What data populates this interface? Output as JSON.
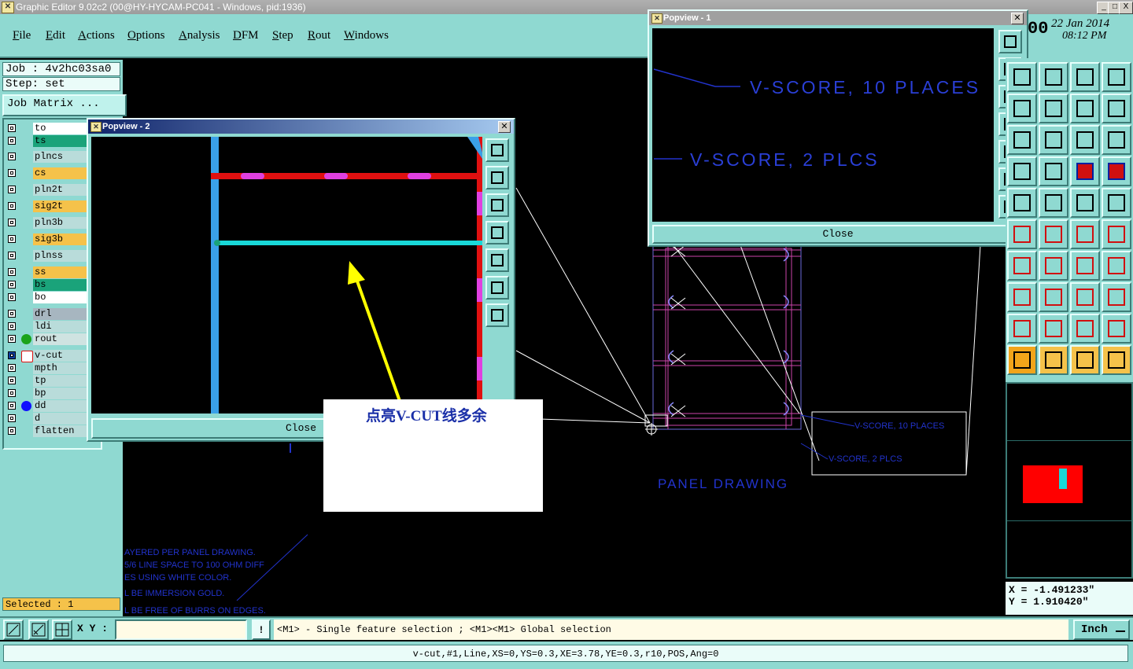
{
  "window": {
    "title": "Graphic Editor 9.02c2 (00@HY-HYCAM-PC041 - Windows, pid:1936)",
    "buttons": [
      "_",
      "□",
      "X"
    ]
  },
  "menu": [
    "File",
    "Edit",
    "Actions",
    "Options",
    "Analysis",
    "DFM",
    "Step",
    "Rout",
    "Windows"
  ],
  "datetime": {
    "clock": "00",
    "date": "22 Jan 2014",
    "time": "08:12 PM"
  },
  "job": {
    "job_label": "Job : 4v2hc03sa0",
    "step_label": "Step: set",
    "matrix_button": "Job Matrix ..."
  },
  "layers": [
    {
      "name": "to",
      "color": "#ffffff"
    },
    {
      "name": "ts",
      "color": "#1aa37a"
    },
    {
      "name": "plncs",
      "color": "#b9dcda"
    },
    {
      "name": "cs",
      "color": "#f5c24a"
    },
    {
      "name": "pln2t",
      "color": "#b9dcda"
    },
    {
      "name": "sig2t",
      "color": "#f5c24a"
    },
    {
      "name": "pln3b",
      "color": "#b9dcda"
    },
    {
      "name": "sig3b",
      "color": "#f5c24a"
    },
    {
      "name": "plnss",
      "color": "#b9dcda"
    },
    {
      "name": "ss",
      "color": "#f5c24a"
    },
    {
      "name": "bs",
      "color": "#1aa37a"
    },
    {
      "name": "bo",
      "color": "#ffffff"
    },
    {
      "name": "drl",
      "color": "#a7b6c0"
    },
    {
      "name": "ldi",
      "color": "#b9dcda"
    },
    {
      "name": "rout",
      "color": "#cfe3e1"
    },
    {
      "name": "v-cut",
      "color": "#b9dcda"
    },
    {
      "name": "mpth",
      "color": "#b9dcda"
    },
    {
      "name": "tp",
      "color": "#b9dcda"
    },
    {
      "name": "bp",
      "color": "#b9dcda"
    },
    {
      "name": "dd",
      "color": "#b9dcda"
    },
    {
      "name": "d",
      "color": "#b9dcda"
    },
    {
      "name": "flatten",
      "color": "#b9dcda"
    }
  ],
  "selected": "Selected : 1",
  "popview1": {
    "title": "Popview - 1",
    "line1": "V-SCORE, 10 PLACES",
    "line2": "V-SCORE, 2 PLCS",
    "close": "Close"
  },
  "popview2": {
    "title": "Popview - 2",
    "close": "Close"
  },
  "annotation": "点亮V-CUT线多余",
  "canvas_text": {
    "vscore10": "V-SCORE, 10 PLACES",
    "vscore2": "V-SCORE, 2 PLCS",
    "panel": "PANEL DRAWING",
    "notes": [
      "AYERED PER PANEL DRAWING.",
      "5/6 LINE SPACE TO 100 OHM DIFF",
      "ES USING WHITE COLOR.",
      "L BE IMMERSION GOLD.",
      "L BE FREE OF BURRS ON EDGES."
    ]
  },
  "coords": {
    "x": "X = -1.491233\"",
    "y": "Y = 1.910420\""
  },
  "bottombar": {
    "xy_label": "X Y :",
    "xy_value": "",
    "warn": "!",
    "hint": "<M1> - Single feature selection ; <M1><M1> Global selection",
    "units": "Inch"
  },
  "status": "v-cut,#1,Line,XS=0,YS=0.3,XE=3.78,YE=0.3,r10,POS,Ang=0"
}
